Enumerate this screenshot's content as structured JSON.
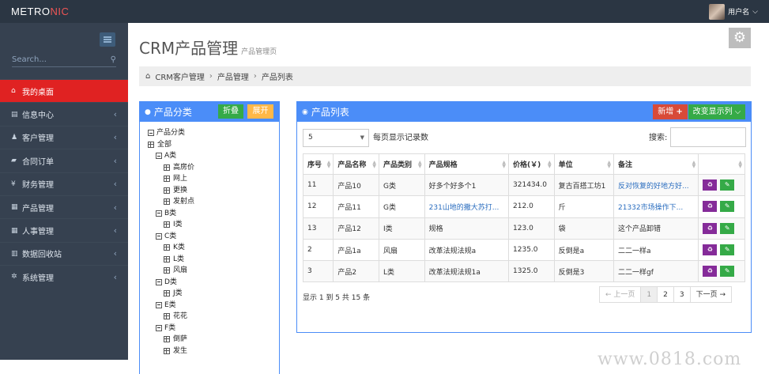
{
  "topbar": {
    "logo_main": "METRO",
    "logo_accent": "NIC",
    "user_name": "用户名",
    "user_caret": "⌵"
  },
  "sidebar": {
    "search_placeholder": "Search...",
    "items": [
      {
        "icon": "home-icon",
        "glyph": "⌂",
        "label": "我的桌面",
        "active": true
      },
      {
        "icon": "calendar-icon",
        "glyph": "▤",
        "label": "信息中心",
        "chev": "‹"
      },
      {
        "icon": "user-icon",
        "glyph": "♟",
        "label": "客户管理",
        "chev": "‹"
      },
      {
        "icon": "book-icon",
        "glyph": "▰",
        "label": "合同订单",
        "chev": "‹"
      },
      {
        "icon": "yen-icon",
        "glyph": "¥",
        "label": "财务管理",
        "chev": "‹"
      },
      {
        "icon": "table-icon",
        "glyph": "▦",
        "label": "产品管理",
        "chev": "‹"
      },
      {
        "icon": "table-icon",
        "glyph": "▦",
        "label": "人事管理",
        "chev": "‹"
      },
      {
        "icon": "trash-icon",
        "glyph": "▥",
        "label": "数据回收站",
        "chev": "‹"
      },
      {
        "icon": "gear-icon",
        "glyph": "✲",
        "label": "系统管理",
        "chev": "‹"
      }
    ]
  },
  "page": {
    "title": "CRM产品管理",
    "subtitle": "产品管理页"
  },
  "breadcrumb": {
    "home_icon": "⌂",
    "items": [
      "CRM客户管理",
      "产品管理",
      "产品列表"
    ],
    "sep": "›"
  },
  "category_panel": {
    "title": "产品分类",
    "fold_label": "折叠",
    "expand_label": "展开",
    "tree": [
      {
        "label": "产品分类",
        "level": 1,
        "type": "folder"
      },
      {
        "label": "全部",
        "level": 1,
        "type": "leaf"
      },
      {
        "label": "A类",
        "level": 2,
        "type": "folder"
      },
      {
        "label": "高房价",
        "level": 3,
        "type": "leaf"
      },
      {
        "label": "网上",
        "level": 3,
        "type": "leaf"
      },
      {
        "label": "更换",
        "level": 3,
        "type": "leaf"
      },
      {
        "label": "发射点",
        "level": 3,
        "type": "leaf"
      },
      {
        "label": "B类",
        "level": 2,
        "type": "folder"
      },
      {
        "label": "I类",
        "level": 3,
        "type": "leaf"
      },
      {
        "label": "C类",
        "level": 2,
        "type": "folder"
      },
      {
        "label": "K类",
        "level": 3,
        "type": "leaf"
      },
      {
        "label": "L类",
        "level": 3,
        "type": "leaf"
      },
      {
        "label": "风扇",
        "level": 3,
        "type": "leaf"
      },
      {
        "label": "D类",
        "level": 2,
        "type": "folder"
      },
      {
        "label": "J类",
        "level": 3,
        "type": "leaf"
      },
      {
        "label": "E类",
        "level": 2,
        "type": "folder"
      },
      {
        "label": "花花",
        "level": 3,
        "type": "leaf"
      },
      {
        "label": "F类",
        "level": 2,
        "type": "folder"
      },
      {
        "label": "倒萨",
        "level": 3,
        "type": "leaf"
      },
      {
        "label": "发生",
        "level": 3,
        "type": "leaf"
      }
    ]
  },
  "product_panel": {
    "title": "产品列表",
    "new_label": "新增",
    "columns_label": "改变显示列",
    "page_size": "5",
    "page_size_label": "每页显示记录数",
    "search_label": "搜索:",
    "headers": [
      "序号",
      "产品名称",
      "产品类别",
      "产品规格",
      "价格(￥)",
      "单位",
      "备注",
      ""
    ],
    "rows": [
      [
        "11",
        "产品10",
        "G类",
        "好多个好多个1",
        "321434.0",
        "复古百搭工坊1",
        "反对恢复的好地方好..."
      ],
      [
        "12",
        "产品11",
        "G类",
        "231山地的撒大苏打...",
        "212.0",
        "斤",
        "21332市场操作下..."
      ],
      [
        "13",
        "产品12",
        "I类",
        "规格",
        "123.0",
        "袋",
        "这个产品卸错"
      ],
      [
        "2",
        "产品1a",
        "风扇",
        "改革法规法规a",
        "1235.0",
        "反倒是a",
        "二二一样a"
      ],
      [
        "3",
        "产品2",
        "L类",
        "改革法规法规1a",
        "1325.0",
        "反倒是3",
        "二二一样gf"
      ]
    ],
    "link_cells": [
      [
        0,
        6
      ],
      [
        1,
        3
      ],
      [
        1,
        6
      ]
    ],
    "info": "显示 1 到 5 共 15 条",
    "pager": {
      "prev": "← 上一页",
      "pages": [
        "1",
        "2",
        "3"
      ],
      "next": "下一页 →",
      "current": "1"
    }
  },
  "watermark": "www.0818.com"
}
